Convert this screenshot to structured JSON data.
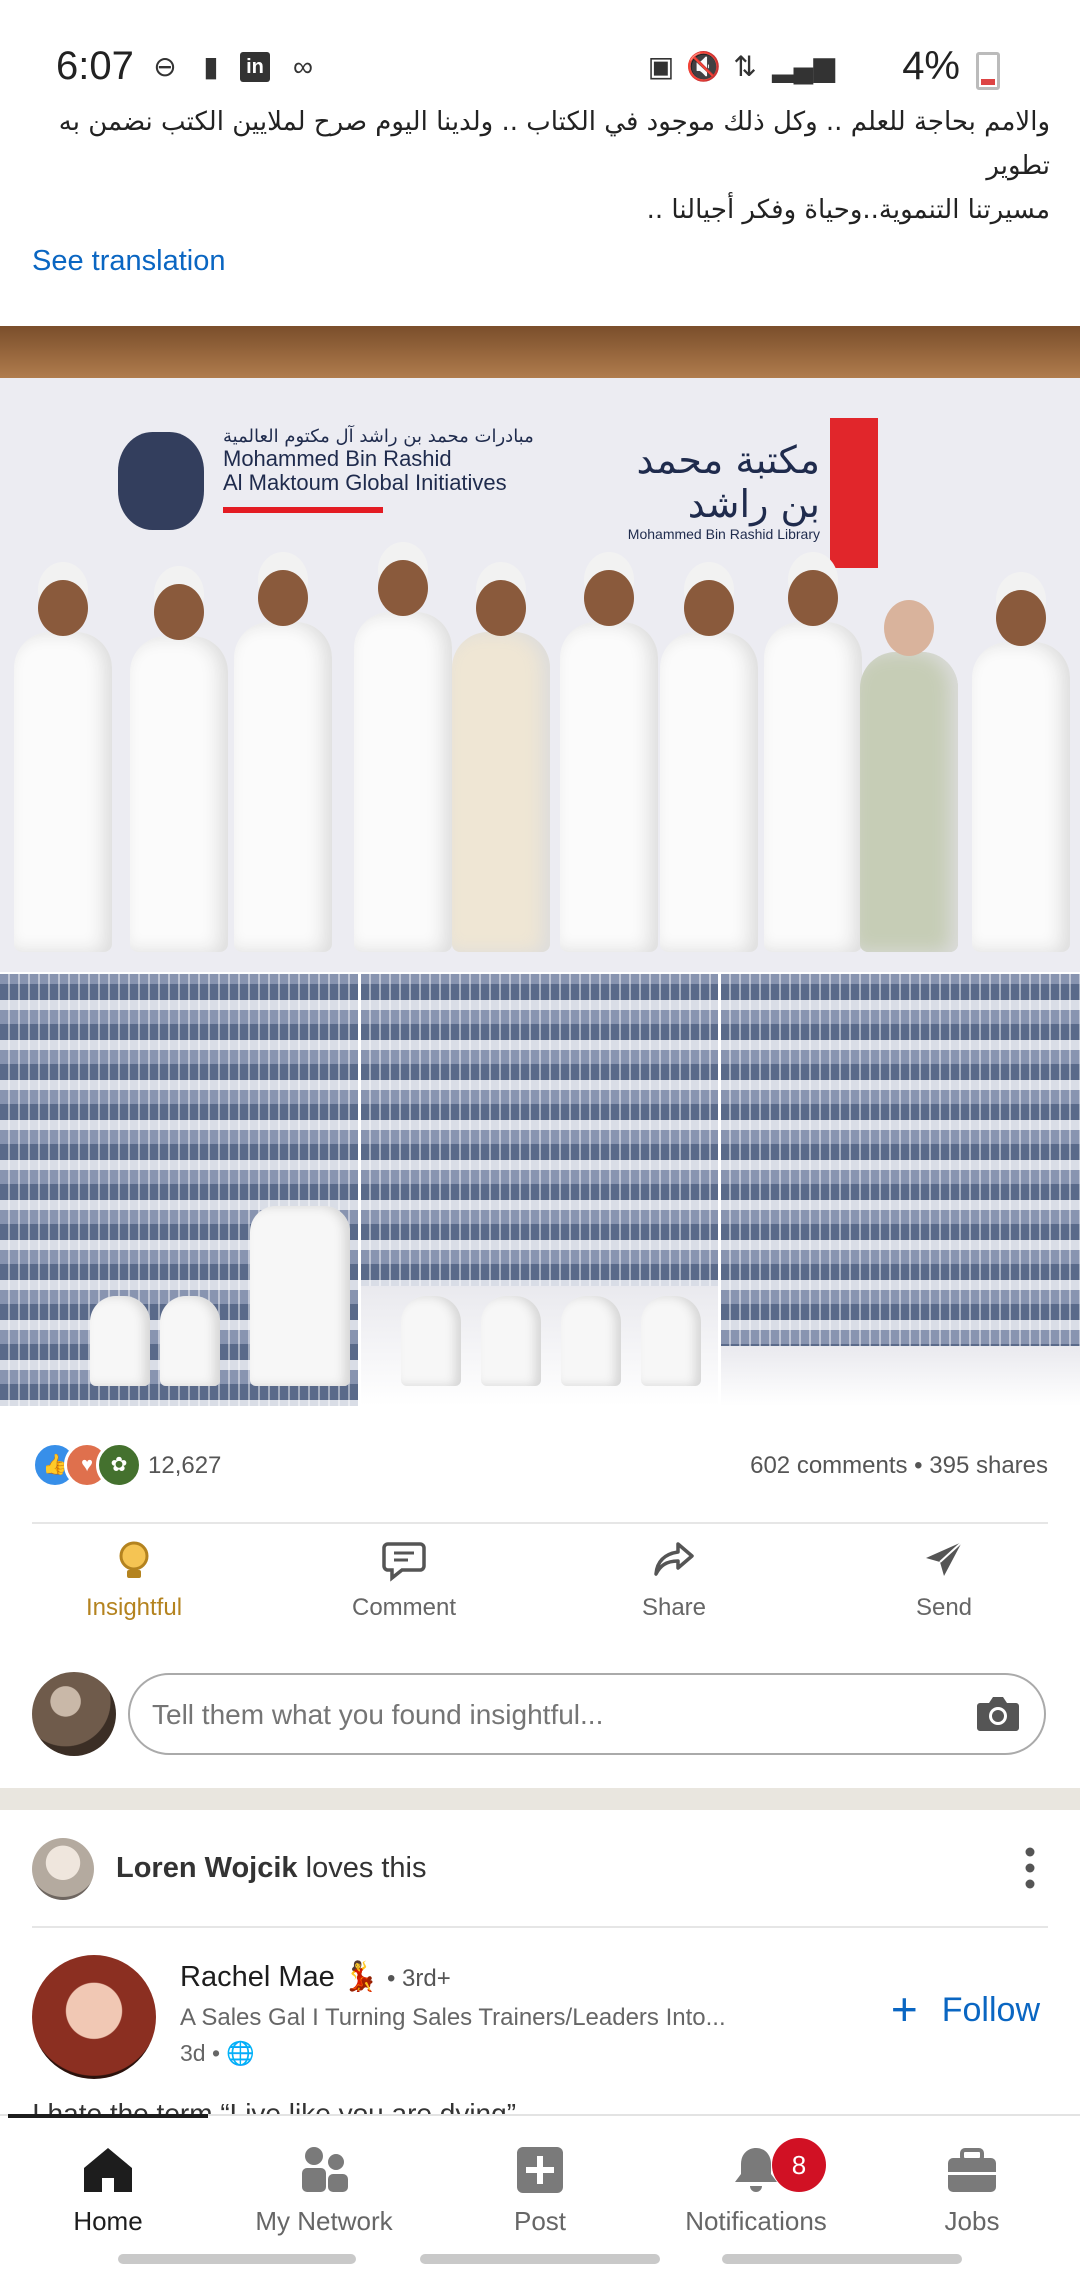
{
  "status_bar": {
    "time": "6:07",
    "battery": "4%",
    "left_icons": [
      "do-not-disturb-icon",
      "alert-icon",
      "linkedin-icon",
      "voicemail-icon"
    ],
    "right_icons": [
      "battery-saver-icon",
      "mute-icon",
      "data-icon",
      "signal-icon",
      "battery-icon"
    ]
  },
  "post": {
    "text_line1": "والامم بحاجة للعلم .. وكل ذلك موجود في الكتاب .. ولدينا اليوم صرح لملايين الكتب نضمن به تطوير",
    "text_line2": "مسيرتنا التنموية..وحياة وفكر أجيالنا ..",
    "see_translation": "See translation",
    "hero_banner": {
      "left_arabic": "مبادرات محمد بن راشد آل مكتوم العالمية",
      "left_en_line1": "Mohammed Bin Rashid",
      "left_en_line2": "Al Maktoum Global Initiatives",
      "right_arabic": "مكتبة محمد بن راشد",
      "right_en": "Mohammed Bin Rashid Library"
    },
    "reaction_count": "12,627",
    "comments_shares": "602 comments • 395 shares",
    "reaction_icons": [
      "like-icon",
      "love-icon",
      "celebrate-icon"
    ]
  },
  "actions": [
    {
      "label": "Insightful",
      "icon": "lightbulb-icon",
      "active": true
    },
    {
      "label": "Comment",
      "icon": "comment-icon",
      "active": false
    },
    {
      "label": "Share",
      "icon": "share-icon",
      "active": false
    },
    {
      "label": "Send",
      "icon": "send-icon",
      "active": false
    }
  ],
  "comment_box": {
    "placeholder": "Tell them what you found insightful..."
  },
  "next_post": {
    "loved_by": "Loren Wojcik",
    "loves_suffix": " loves this",
    "author_name": "Rachel Mae",
    "author_emoji": "💃",
    "degree": "• 3rd+",
    "headline": "A Sales Gal I Turning Sales Trainers/Leaders Into...",
    "time": "3d •",
    "follow_label": "Follow",
    "peek_text": "I hate the term “Live like you are dying”"
  },
  "bottom_nav": [
    {
      "label": "Home",
      "icon": "home-icon",
      "active": true
    },
    {
      "label": "My Network",
      "icon": "network-icon",
      "active": false
    },
    {
      "label": "Post",
      "icon": "post-icon",
      "active": false
    },
    {
      "label": "Notifications",
      "icon": "bell-icon",
      "active": false,
      "badge": "8"
    },
    {
      "label": "Jobs",
      "icon": "briefcase-icon",
      "active": false
    }
  ],
  "colors": {
    "linkedin_blue": "#0a66c2",
    "insightful_gold": "#b4831f",
    "badge_red": "#d11124"
  }
}
